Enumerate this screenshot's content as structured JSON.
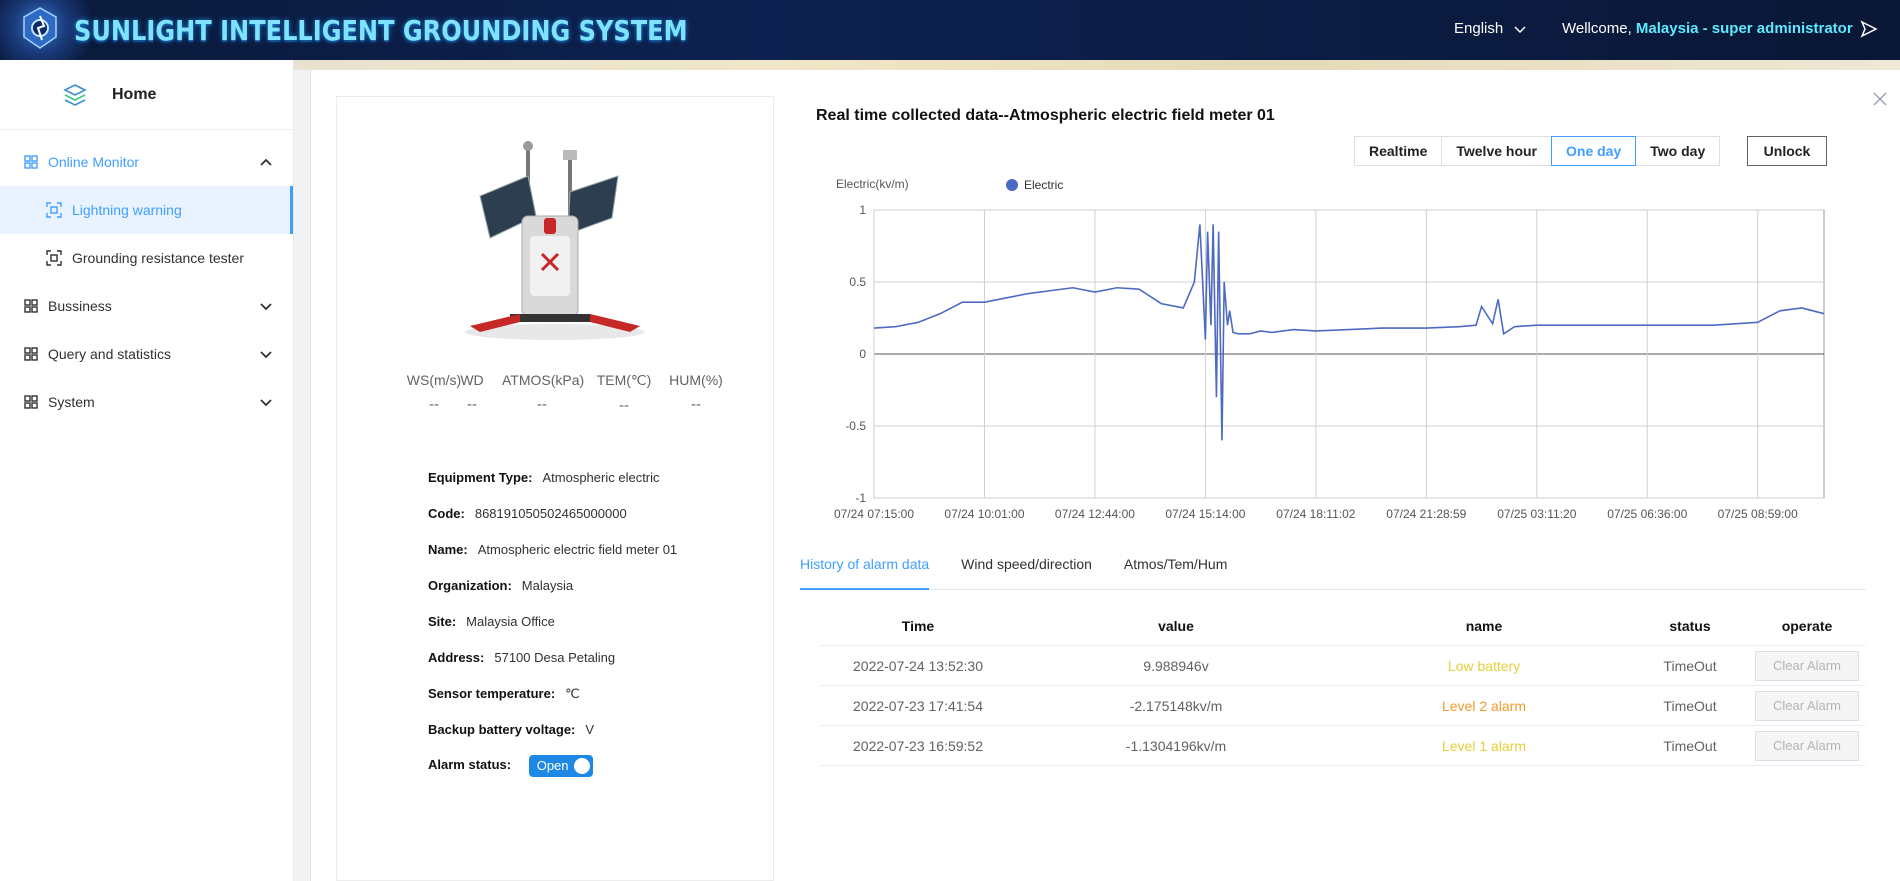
{
  "header": {
    "title": "SUNLIGHT INTELLIGENT GROUNDING SYSTEM",
    "language": "English",
    "welcome_prefix": "Wellcome,",
    "user": "Malaysia - super administrator"
  },
  "sidebar": {
    "home": "Home",
    "items": [
      {
        "label": "Online Monitor"
      },
      {
        "label": "Lightning warning"
      },
      {
        "label": "Grounding resistance tester"
      },
      {
        "label": "Bussiness"
      },
      {
        "label": "Query and statistics"
      },
      {
        "label": "System"
      }
    ]
  },
  "device": {
    "metrics": [
      {
        "label": "WS(m/s)",
        "value": "--"
      },
      {
        "label": "WD",
        "value": "--"
      },
      {
        "label": "ATMOS(kPa)",
        "value": "--"
      },
      {
        "label": "TEM(℃)",
        "value": "--"
      },
      {
        "label": "HUM(%)",
        "value": "--"
      }
    ],
    "info": [
      {
        "key": "Equipment Type:",
        "value": "Atmospheric electric"
      },
      {
        "key": "Code:",
        "value": "868191050502465000000"
      },
      {
        "key": "Name:",
        "value": "Atmospheric electric field meter 01"
      },
      {
        "key": "Organization:",
        "value": "Malaysia"
      },
      {
        "key": "Site:",
        "value": "Malaysia Office"
      },
      {
        "key": "Address:",
        "value": "57100 Desa Petaling"
      },
      {
        "key": "Sensor temperature:",
        "value": "℃"
      },
      {
        "key": "Backup battery voltage:",
        "value": "V"
      }
    ],
    "alarm_status_label": "Alarm status:",
    "alarm_status_value": "Open"
  },
  "chart_title": "Real time collected data--Atmospheric electric field meter 01",
  "ranges": [
    "Realtime",
    "Twelve hour",
    "One day",
    "Two day"
  ],
  "selected_range": "One day",
  "unlock_label": "Unlock",
  "chart_data": {
    "type": "line",
    "ylabel": "Electric(kv/m)",
    "ylim": [
      -1,
      1
    ],
    "yticks": [
      "1",
      "0.5",
      "0",
      "-0.5",
      "-1"
    ],
    "xticks": [
      "07/24 07:15:00",
      "07/24 10:01:00",
      "07/24 12:44:00",
      "07/24 15:14:00",
      "07/24 18:11:02",
      "07/24 21:28:59",
      "07/25 03:11:20",
      "07/25 06:36:00",
      "07/25 08:59:00"
    ],
    "grid": true,
    "legend": "top-left",
    "series": [
      {
        "name": "Electric",
        "color": "#4d6ac3",
        "x": [
          0,
          0.2,
          0.4,
          0.6,
          0.8,
          1.0,
          1.2,
          1.4,
          1.6,
          1.8,
          2.0,
          2.2,
          2.4,
          2.6,
          2.8,
          2.9,
          2.95,
          3.0,
          3.02,
          3.05,
          3.07,
          3.1,
          3.12,
          3.15,
          3.17,
          3.2,
          3.22,
          3.25,
          3.3,
          3.4,
          3.5,
          3.6,
          3.8,
          4.0,
          4.3,
          4.6,
          5.0,
          5.3,
          5.45,
          5.5,
          5.6,
          5.65,
          5.7,
          5.8,
          6.0,
          6.4,
          6.8,
          7.2,
          7.6,
          8.0,
          8.2,
          8.4,
          8.6
        ],
        "values": [
          0.18,
          0.19,
          0.22,
          0.28,
          0.36,
          0.36,
          0.39,
          0.42,
          0.44,
          0.46,
          0.43,
          0.46,
          0.45,
          0.35,
          0.32,
          0.5,
          0.9,
          0.1,
          0.85,
          0.2,
          0.9,
          -0.3,
          0.85,
          -0.6,
          0.5,
          0.2,
          0.3,
          0.15,
          0.14,
          0.14,
          0.16,
          0.15,
          0.17,
          0.16,
          0.17,
          0.18,
          0.18,
          0.19,
          0.2,
          0.33,
          0.21,
          0.38,
          0.14,
          0.19,
          0.2,
          0.2,
          0.2,
          0.2,
          0.2,
          0.22,
          0.3,
          0.32,
          0.28
        ]
      }
    ]
  },
  "tabs": [
    "History of alarm data",
    "Wind speed/direction",
    "Atmos/Tem/Hum"
  ],
  "table": {
    "headers": [
      "Time",
      "value",
      "name",
      "status",
      "operate"
    ],
    "rows": [
      {
        "time": "2022-07-24 13:52:30",
        "value": "9.988946v",
        "name": "Low battery",
        "name_color": "#e6cf3a",
        "status": "TimeOut",
        "op": "Clear Alarm"
      },
      {
        "time": "2022-07-23 17:41:54",
        "value": "-2.175148kv/m",
        "name": "Level 2 alarm",
        "name_color": "#f29b2c",
        "status": "TimeOut",
        "op": "Clear Alarm"
      },
      {
        "time": "2022-07-23 16:59:52",
        "value": "-1.1304196kv/m",
        "name": "Level 1 alarm",
        "name_color": "#e6cf3a",
        "status": "TimeOut",
        "op": "Clear Alarm"
      }
    ]
  }
}
